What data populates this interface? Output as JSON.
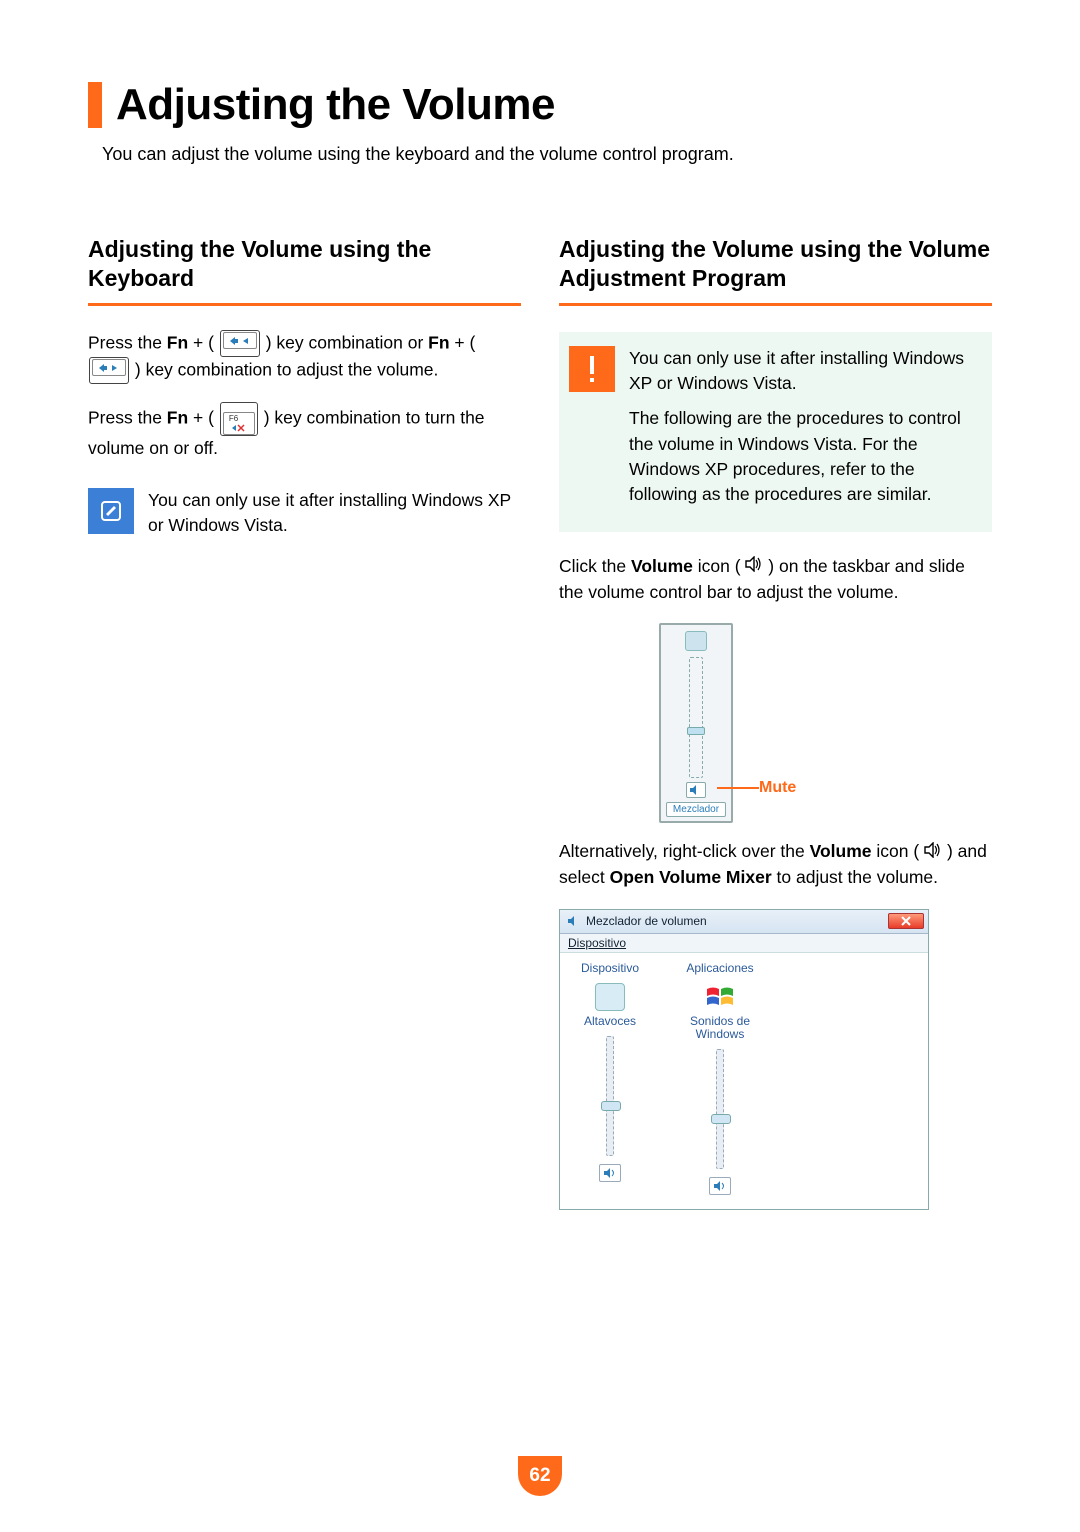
{
  "title": "Adjusting the Volume",
  "intro": "You can adjust the volume using the keyboard and the volume control program.",
  "left": {
    "heading": "Adjusting the Volume using the Keyboard",
    "para1_pre": "Press the ",
    "fn": "Fn",
    "plus_open": " + (",
    "close_post1": ") key combination or ",
    "plus_open2": " + (",
    "close_post2": ") key combination to adjust the volume.",
    "para2_pre": "Press the ",
    "close_post3": ") key combination to turn the volume on or off.",
    "note": "You can only use it after installing Windows XP or Windows Vista."
  },
  "right": {
    "heading": "Adjusting the Volume using the Volume Adjustment Program",
    "warn1": "You can only use it after installing Windows XP or Windows Vista.",
    "warn2": "The following are the procedures to control the volume in Windows Vista. For the Windows XP procedures, refer to the following as the procedures are similar.",
    "click_pre": "Click the ",
    "volume_word": "Volume",
    "click_mid": " icon (",
    "click_post": ") on the taskbar and slide the volume control bar to adjust the volume.",
    "mute_label": "Mute",
    "mezclador": "Mezclador",
    "alt_pre": "Alternatively, right-click over the ",
    "alt_mid": " icon (",
    "alt_post1": ") and select ",
    "open_mixer": "Open Volume Mixer",
    "alt_post2": " to adjust the volume.",
    "mixer": {
      "title": "Mezclador de volumen",
      "menu": "Dispositivo",
      "col1header": "Dispositivo",
      "col2header": "Aplicaciones",
      "col1label": "Altavoces",
      "col2label": "Sonidos de Windows"
    }
  },
  "page_number": "62",
  "key_labels": {
    "f6": "F6"
  }
}
